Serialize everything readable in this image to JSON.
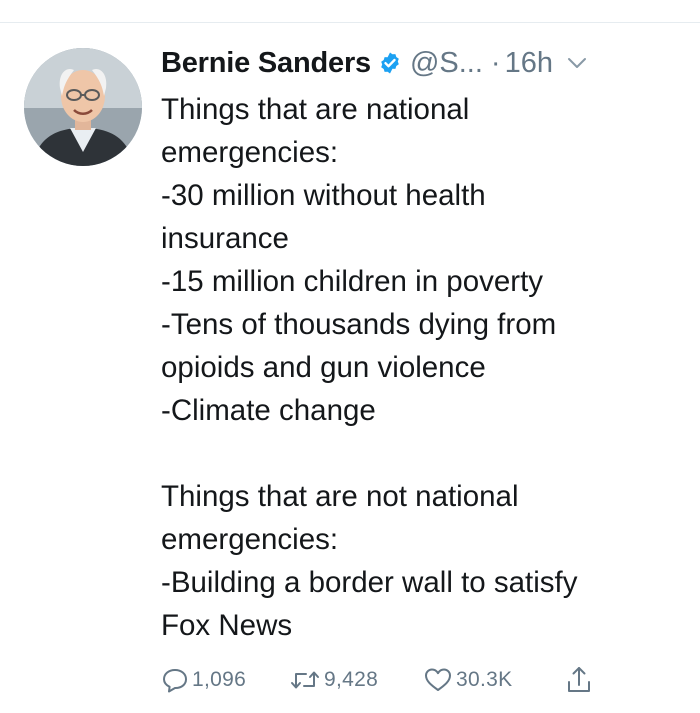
{
  "tweet": {
    "author_name": "Bernie Sanders",
    "handle": "@S...",
    "separator": "·",
    "time": "16h",
    "lines": [
      "Things that are national",
      "emergencies:",
      "-30 million without health",
      "insurance",
      "-15 million children in poverty",
      "-Tens of thousands dying from",
      "opioids and gun violence",
      "-Climate change",
      "",
      "Things that are not national",
      "emergencies:",
      "-Building a border wall to satisfy",
      "Fox News"
    ],
    "stats": {
      "replies": "1,096",
      "retweets": "9,428",
      "likes": "30.3K"
    }
  },
  "colors": {
    "text": "#14171a",
    "secondary": "#657786",
    "verified_badge": "#1da1f2",
    "divider": "#e6ecf0"
  },
  "icons": {
    "verified": "verified-badge-icon",
    "more": "chevron-down-icon",
    "reply": "reply-bubble-icon",
    "retweet": "retweet-icon",
    "like": "heart-icon",
    "share": "share-icon"
  }
}
